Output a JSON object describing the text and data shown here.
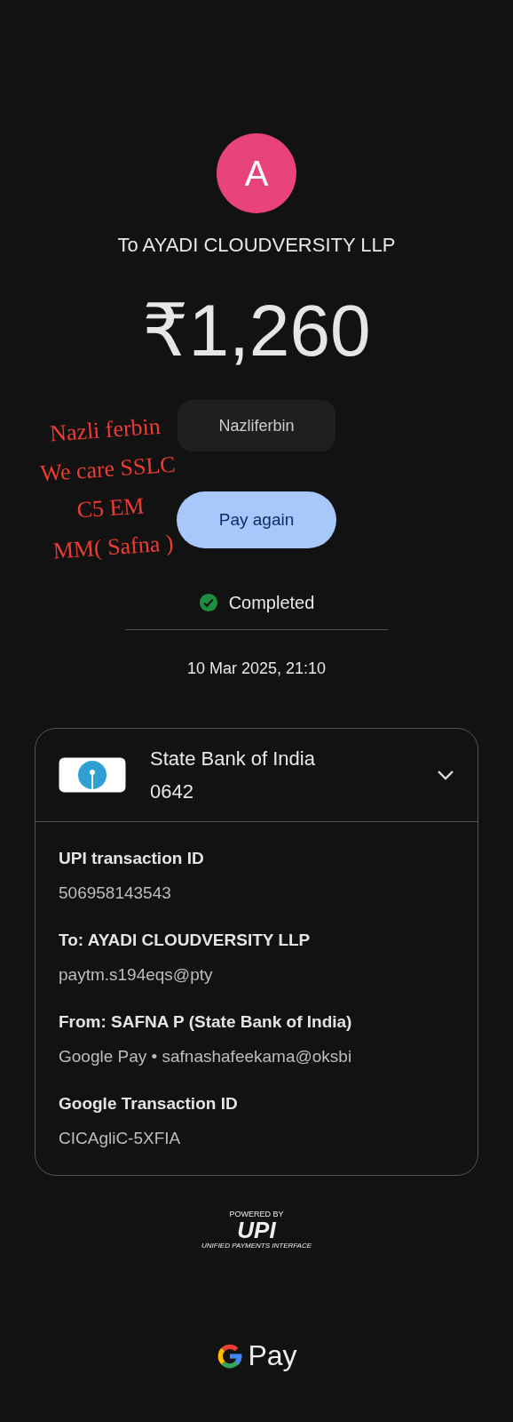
{
  "recipient": {
    "avatar_letter": "A",
    "title": "To AYADI CLOUDVERSITY LLP"
  },
  "amount": "₹1,260",
  "note": "Nazliferbin",
  "annotation": [
    "Nazli ferbin",
    "We care SSLC",
    "C5 EM",
    "MM( Safna )"
  ],
  "action": "Pay again",
  "status": {
    "kind": "completed",
    "label": "Completed"
  },
  "date": "10 Mar 2025, 21:10",
  "account": {
    "bank": "State Bank of India",
    "number": "0642",
    "expanded": true
  },
  "details": [
    {
      "label": "UPI transaction ID",
      "value": "506958143543"
    },
    {
      "label": "To: AYADI CLOUDVERSITY LLP",
      "value": "paytm.s194eqs@pty"
    },
    {
      "label": "From: SAFNA  P (State Bank of India)",
      "value": "Google Pay • safnashafeekama@oksbi"
    },
    {
      "label": "Google Transaction ID",
      "value": "CICAgliC-5XFIA"
    }
  ],
  "footer": {
    "powered_by": "POWERED BY",
    "upi": "UPI",
    "upi_caption": "UNIFIED PAYMENTS INTERFACE",
    "brand": "Pay"
  }
}
